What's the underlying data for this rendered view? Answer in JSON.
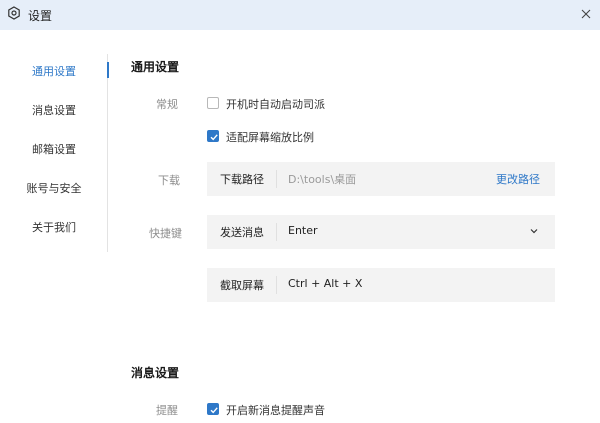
{
  "window": {
    "title": "设置",
    "close_icon": "close-icon",
    "app_icon": "gear-icon"
  },
  "sidebar": {
    "items": [
      {
        "label": "通用设置",
        "active": true
      },
      {
        "label": "消息设置",
        "active": false
      },
      {
        "label": "邮箱设置",
        "active": false
      },
      {
        "label": "账号与安全",
        "active": false
      },
      {
        "label": "关于我们",
        "active": false
      }
    ]
  },
  "general": {
    "title": "通用设置",
    "startup": {
      "label": "常规",
      "options": [
        {
          "text": "开机时自动启动司派",
          "checked": false
        },
        {
          "text": "适配屏幕缩放比例",
          "checked": true
        }
      ]
    },
    "download": {
      "label": "下载",
      "key": "下载路径",
      "path": "D:\\tools\\桌面",
      "action": "更改路径"
    },
    "shortcuts": {
      "label": "快捷键",
      "send": {
        "key": "发送消息",
        "value": "Enter"
      },
      "screenshot": {
        "key": "截取屏幕",
        "value": "Ctrl + Alt + X"
      }
    }
  },
  "message": {
    "title": "消息设置",
    "reminder": {
      "label": "提醒",
      "text": "开启新消息提醒声音",
      "checked": true
    }
  },
  "colors": {
    "accent": "#2e78c8",
    "titlebar": "#e6eef9",
    "field_bg": "#f3f3f3"
  }
}
